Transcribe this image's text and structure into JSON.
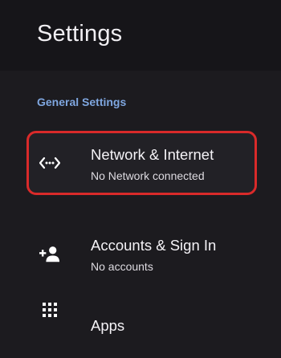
{
  "header": {
    "title": "Settings"
  },
  "section": {
    "label": "General Settings"
  },
  "items": [
    {
      "label": "Network & Internet",
      "sub": "No Network connected",
      "icon": "network-icon",
      "selected": true
    },
    {
      "label": "Accounts & Sign In",
      "sub": "No accounts",
      "icon": "add-account-icon",
      "selected": false
    },
    {
      "label": "Apps",
      "sub": "",
      "icon": "apps-grid-icon",
      "selected": false
    }
  ],
  "colors": {
    "background": "#1c1b1f",
    "header_background": "#161519",
    "section_label": "#7fa7e0",
    "highlight_border": "#d92a2a"
  }
}
